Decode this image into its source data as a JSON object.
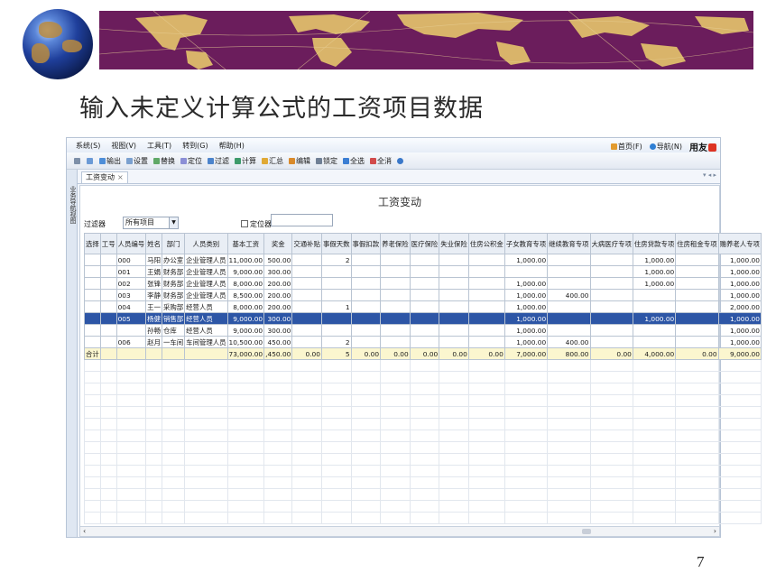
{
  "slide": {
    "title": "输入未定义计算公式的工资项目数据",
    "page_number": "7"
  },
  "app": {
    "menus": [
      "系统(S)",
      "视图(V)",
      "工具(T)",
      "转到(G)",
      "帮助(H)"
    ],
    "right_links": [
      "首页(F)",
      "导航(N)"
    ],
    "brand": "用友",
    "toolbar": [
      "输出",
      "设置",
      "替换",
      "定位",
      "过滤",
      "计算",
      "汇总",
      "编辑",
      "锁定",
      "全选",
      "全消"
    ],
    "left_tab": "业务导航视图",
    "tab_label": "工资变动",
    "view_title": "工资变动",
    "filter_label": "过滤器",
    "filter_value": "所有项目",
    "locator_label": "定位器"
  },
  "grid": {
    "columns": [
      "选择",
      "工号",
      "人员编号",
      "姓名",
      "部门",
      "人员类别",
      "基本工资",
      "奖金",
      "交通补贴",
      "事假天数",
      "事假扣款",
      "养老保险",
      "医疗保险",
      "失业保险",
      "住房公积金",
      "子女教育专项",
      "继续教育专项",
      "大病医疗专项",
      "住房贷款专项",
      "住房租金专项",
      "赡养老人专项"
    ],
    "rows": [
      [
        "",
        "",
        "000",
        "马阳",
        "办公室",
        "企业管理人员",
        "11,000.00",
        "500.00",
        "",
        "2",
        "",
        "",
        "",
        "",
        "",
        "1,000.00",
        "",
        "",
        "1,000.00",
        "",
        "1,000.00"
      ],
      [
        "",
        "",
        "001",
        "王娟",
        "财务部",
        "企业管理人员",
        "9,000.00",
        "300.00",
        "",
        "",
        "",
        "",
        "",
        "",
        "",
        "",
        "",
        "",
        "1,000.00",
        "",
        "1,000.00"
      ],
      [
        "",
        "",
        "002",
        "张锋",
        "财务部",
        "企业管理人员",
        "8,000.00",
        "200.00",
        "",
        "",
        "",
        "",
        "",
        "",
        "",
        "1,000.00",
        "",
        "",
        "1,000.00",
        "",
        "1,000.00"
      ],
      [
        "",
        "",
        "003",
        "李静",
        "财务部",
        "企业管理人员",
        "8,500.00",
        "200.00",
        "",
        "",
        "",
        "",
        "",
        "",
        "",
        "1,000.00",
        "400.00",
        "",
        "",
        "",
        "1,000.00"
      ],
      [
        "",
        "",
        "004",
        "王一",
        "采购部",
        "经营人员",
        "8,000.00",
        "200.00",
        "",
        "1",
        "",
        "",
        "",
        "",
        "",
        "1,000.00",
        "",
        "",
        "",
        "",
        "2,000.00"
      ],
      [
        "",
        "",
        "005",
        "杨健",
        "销售部",
        "经营人员",
        "9,000.00",
        "300.00",
        "",
        "",
        "",
        "",
        "",
        "",
        "",
        "1,000.00",
        "",
        "",
        "1,000.00",
        "",
        "1,000.00"
      ],
      [
        "",
        "",
        "",
        "孙畅",
        "仓库",
        "经营人员",
        "9,000.00",
        "300.00",
        "",
        "",
        "",
        "",
        "",
        "",
        "",
        "1,000.00",
        "",
        "",
        "",
        "",
        "1,000.00"
      ],
      [
        "",
        "",
        "006",
        "赵月",
        "一车间",
        "车间管理人员",
        "10,500.00",
        "450.00",
        "",
        "2",
        "",
        "",
        "",
        "",
        "",
        "1,000.00",
        "400.00",
        "",
        "",
        "",
        "1,000.00"
      ]
    ],
    "selected_row": 5,
    "total": [
      "合计",
      "",
      "",
      "",
      "",
      "",
      "73,000.00",
      ",450.00",
      "0.00",
      "5",
      "0.00",
      "0.00",
      "0.00",
      "0.00",
      "0.00",
      "7,000.00",
      "800.00",
      "0.00",
      "4,000.00",
      "0.00",
      "9,000.00"
    ]
  },
  "colors": {
    "banner": "#6b1d5c",
    "map_land": "#d9b46a",
    "selection": "#2d56a6",
    "total_row": "#fbf6cf"
  }
}
